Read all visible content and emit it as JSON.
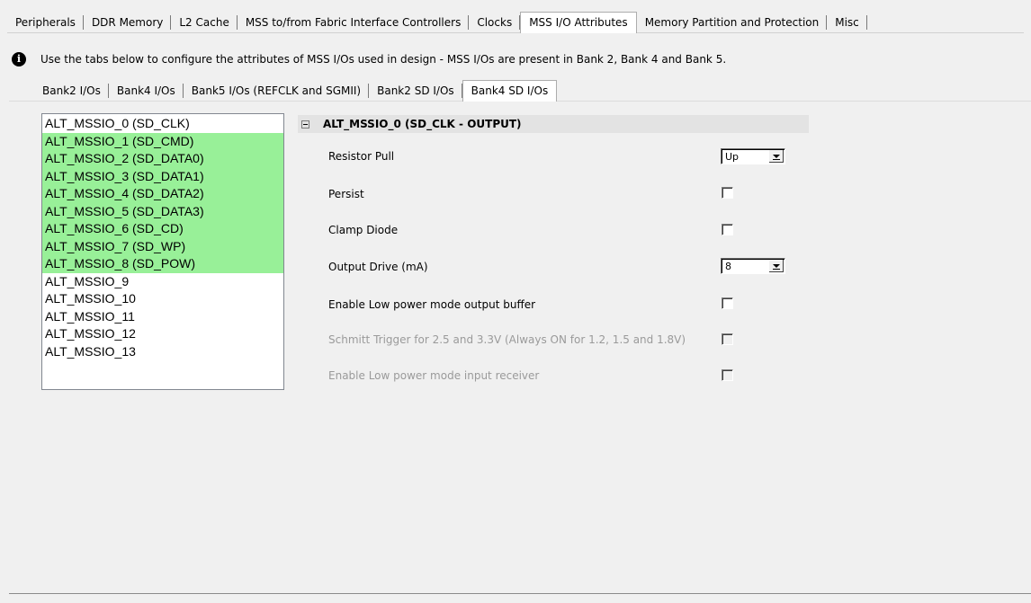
{
  "top_tabs": [
    {
      "label": "Peripherals"
    },
    {
      "label": "DDR Memory"
    },
    {
      "label": "L2 Cache"
    },
    {
      "label": "MSS to/from Fabric Interface Controllers"
    },
    {
      "label": "Clocks"
    },
    {
      "label": "MSS I/O Attributes",
      "active": true
    },
    {
      "label": "Memory Partition and Protection"
    },
    {
      "label": "Misc"
    }
  ],
  "info_text": "Use the tabs below to configure the attributes of MSS I/Os used in design - MSS I/Os are present in Bank 2, Bank 4 and Bank 5.",
  "sub_tabs": [
    {
      "label": "Bank2 I/Os"
    },
    {
      "label": "Bank4 I/Os"
    },
    {
      "label": "Bank5 I/Os (REFCLK and SGMII)"
    },
    {
      "label": "Bank2 SD I/Os"
    },
    {
      "label": "Bank4 SD I/Os",
      "active": true
    }
  ],
  "io_list": [
    {
      "label": "ALT_MSSIO_0 (SD_CLK)",
      "highlighted": false
    },
    {
      "label": "ALT_MSSIO_1 (SD_CMD)",
      "highlighted": true
    },
    {
      "label": "ALT_MSSIO_2 (SD_DATA0)",
      "highlighted": true
    },
    {
      "label": "ALT_MSSIO_3 (SD_DATA1)",
      "highlighted": true
    },
    {
      "label": "ALT_MSSIO_4 (SD_DATA2)",
      "highlighted": true
    },
    {
      "label": "ALT_MSSIO_5 (SD_DATA3)",
      "highlighted": true
    },
    {
      "label": "ALT_MSSIO_6 (SD_CD)",
      "highlighted": true
    },
    {
      "label": "ALT_MSSIO_7 (SD_WP)",
      "highlighted": true
    },
    {
      "label": "ALT_MSSIO_8 (SD_POW)",
      "highlighted": true
    },
    {
      "label": "ALT_MSSIO_9",
      "highlighted": false
    },
    {
      "label": "ALT_MSSIO_10",
      "highlighted": false
    },
    {
      "label": "ALT_MSSIO_11",
      "highlighted": false
    },
    {
      "label": "ALT_MSSIO_12",
      "highlighted": false
    },
    {
      "label": "ALT_MSSIO_13",
      "highlighted": false
    }
  ],
  "properties": {
    "title": "ALT_MSSIO_0 (SD_CLK - OUTPUT)",
    "resistor_pull": {
      "label": "Resistor Pull",
      "value": "Up"
    },
    "persist": {
      "label": "Persist",
      "checked": false
    },
    "clamp_diode": {
      "label": "Clamp Diode",
      "checked": false
    },
    "output_drive": {
      "label": "Output Drive (mA)",
      "value": "8"
    },
    "low_power_output": {
      "label": "Enable Low power mode output buffer",
      "checked": false
    },
    "schmitt_trigger": {
      "label": "Schmitt Trigger for 2.5 and 3.3V (Always ON for 1.2, 1.5 and 1.8V)",
      "checked": false,
      "disabled": true
    },
    "low_power_input": {
      "label": "Enable Low power mode input receiver",
      "checked": false,
      "disabled": true
    }
  },
  "colors": {
    "highlight": "#98f098",
    "background": "#f0f0f0",
    "disabled_text": "#9a9a9a"
  }
}
